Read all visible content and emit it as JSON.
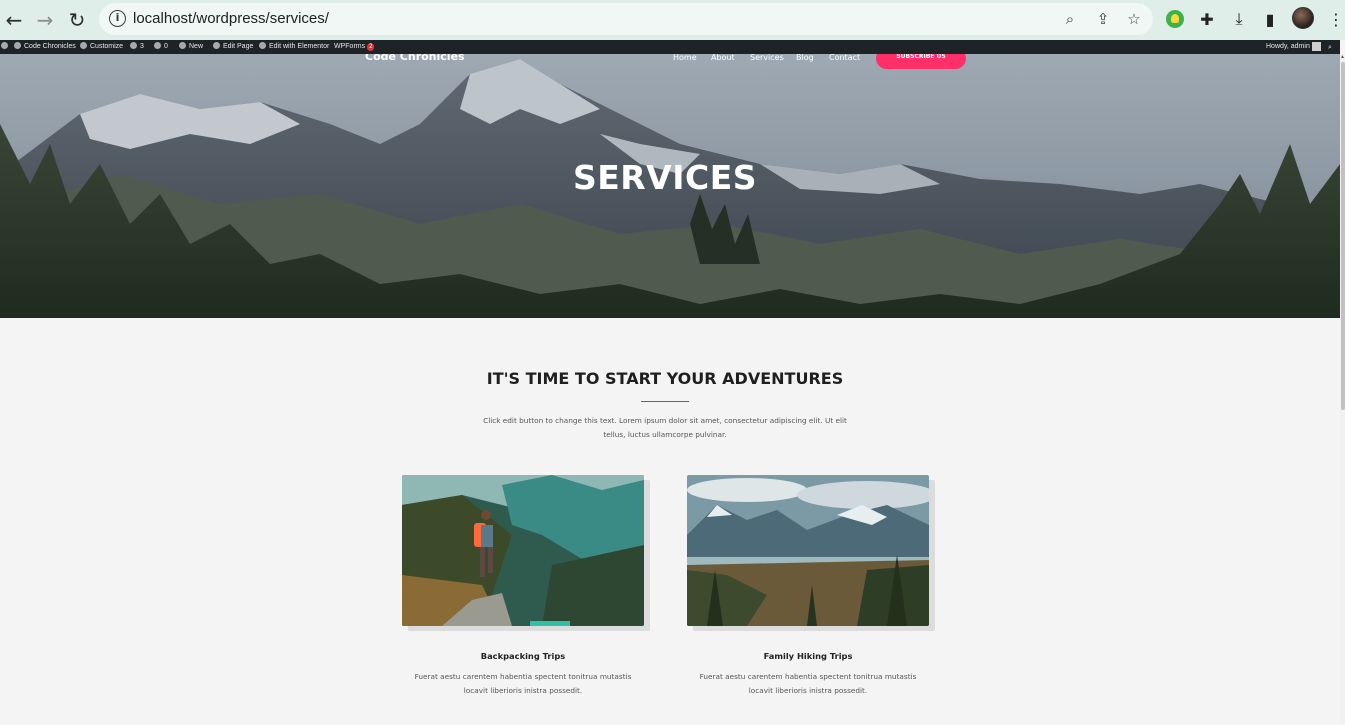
{
  "browser": {
    "url": "localhost/wordpress/services/",
    "back_icon": "arrow-left-icon",
    "forward_icon": "arrow-right-icon",
    "reload_icon": "reload-icon"
  },
  "adminbar": {
    "site_name": "Code Chronicles",
    "customize": "Customize",
    "updates_count": "3",
    "comments_count": "0",
    "new": "New",
    "edit_page": "Edit Page",
    "edit_elementor": "Edit with Elementor",
    "wpforms": "WPForms",
    "wpforms_badge": "2",
    "howdy": "Howdy, admin"
  },
  "site": {
    "title": "Code Chronicles",
    "menu": [
      "Home",
      "About",
      "Services",
      "Blog",
      "Contact"
    ],
    "subscribe": "SUBSCRIBE US",
    "accent_color": "#ff2f6a"
  },
  "hero": {
    "title": "SERVICES"
  },
  "section": {
    "title": "IT'S TIME TO START YOUR ADVENTURES",
    "intro_line1": "Click edit button to change this text. Lorem ipsum dolor sit amet, consectetur adipiscing elit. Ut elit",
    "intro_line2": "tellus, luctus ullamcorpe pulvinar."
  },
  "cards": [
    {
      "title": "Backpacking Trips",
      "desc_line1": "Fuerat aestu carentem habentia spectent tonitrua mutastis",
      "desc_line2": "locavit liberioris inistra possedit."
    },
    {
      "title": "Family Hiking Trips",
      "desc_line1": "Fuerat aestu carentem habentia spectent tonitrua mutastis",
      "desc_line2": "locavit liberioris inistra possedit."
    }
  ]
}
